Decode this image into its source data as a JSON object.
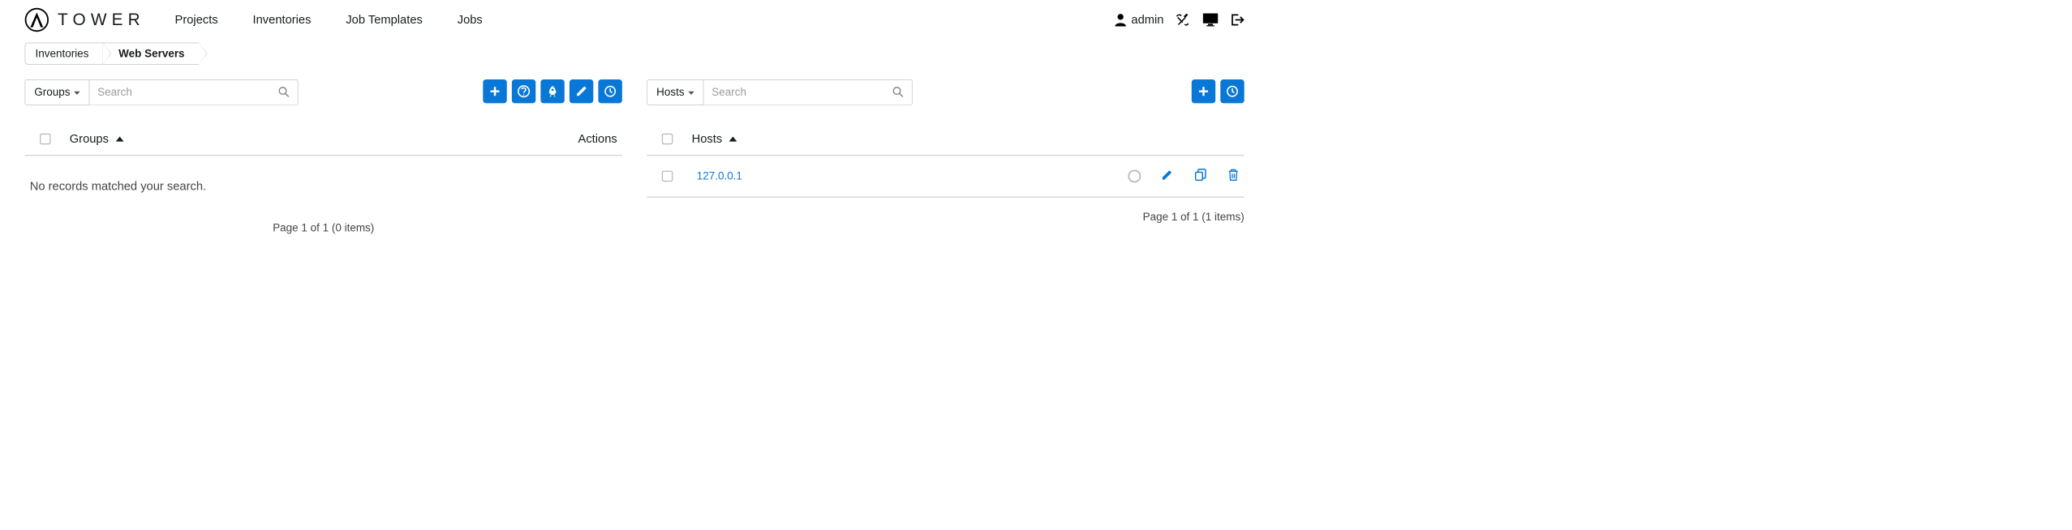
{
  "brand": {
    "name": "TOWER"
  },
  "nav": {
    "items": [
      "Projects",
      "Inventories",
      "Job Templates",
      "Jobs"
    ]
  },
  "user": {
    "name": "admin"
  },
  "breadcrumb": {
    "0": "Inventories",
    "1": "Web Servers"
  },
  "groups_panel": {
    "dropdown_label": "Groups",
    "search_placeholder": "Search",
    "column_name": "Groups",
    "column_actions": "Actions",
    "empty": "No records matched your search.",
    "pager": "Page 1 of 1 (0 items)"
  },
  "hosts_panel": {
    "dropdown_label": "Hosts",
    "search_placeholder": "Search",
    "column_name": "Hosts",
    "rows": [
      {
        "name": "127.0.0.1"
      }
    ],
    "pager": "Page 1 of 1 (1 items)"
  }
}
